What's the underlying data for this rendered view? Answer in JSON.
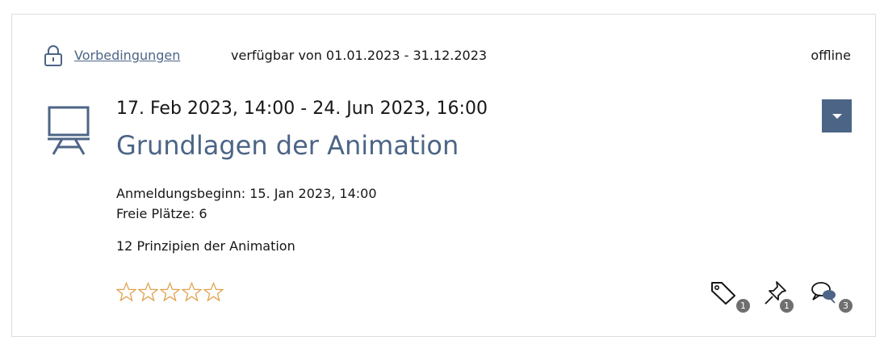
{
  "header": {
    "prerequisites_link": "Vorbedingungen",
    "availability": "verfügbar von 01.01.2023 - 31.12.2023",
    "status": "offline"
  },
  "session": {
    "dates": "17. Feb 2023, 14:00 - 24. Jun 2023, 16:00",
    "title": "Grundlagen der Animation",
    "registration_start": "Anmeldungsbeginn: 15. Jan 2023, 14:00",
    "free_seats": "Freie Plätze: 6",
    "description": "12 Prinzipien der Animation"
  },
  "rating": {
    "stars_filled": 0,
    "stars_total": 5
  },
  "tools": {
    "tags": {
      "icon": "tag-icon",
      "count": "1"
    },
    "notes": {
      "icon": "pin-icon",
      "count": "1"
    },
    "comments": {
      "icon": "comment-icon",
      "count": "3"
    }
  },
  "colors": {
    "accent": "#4c6586",
    "star_outline": "#e0a04a",
    "badge": "#6f6f6f",
    "border": "#dddddd"
  }
}
